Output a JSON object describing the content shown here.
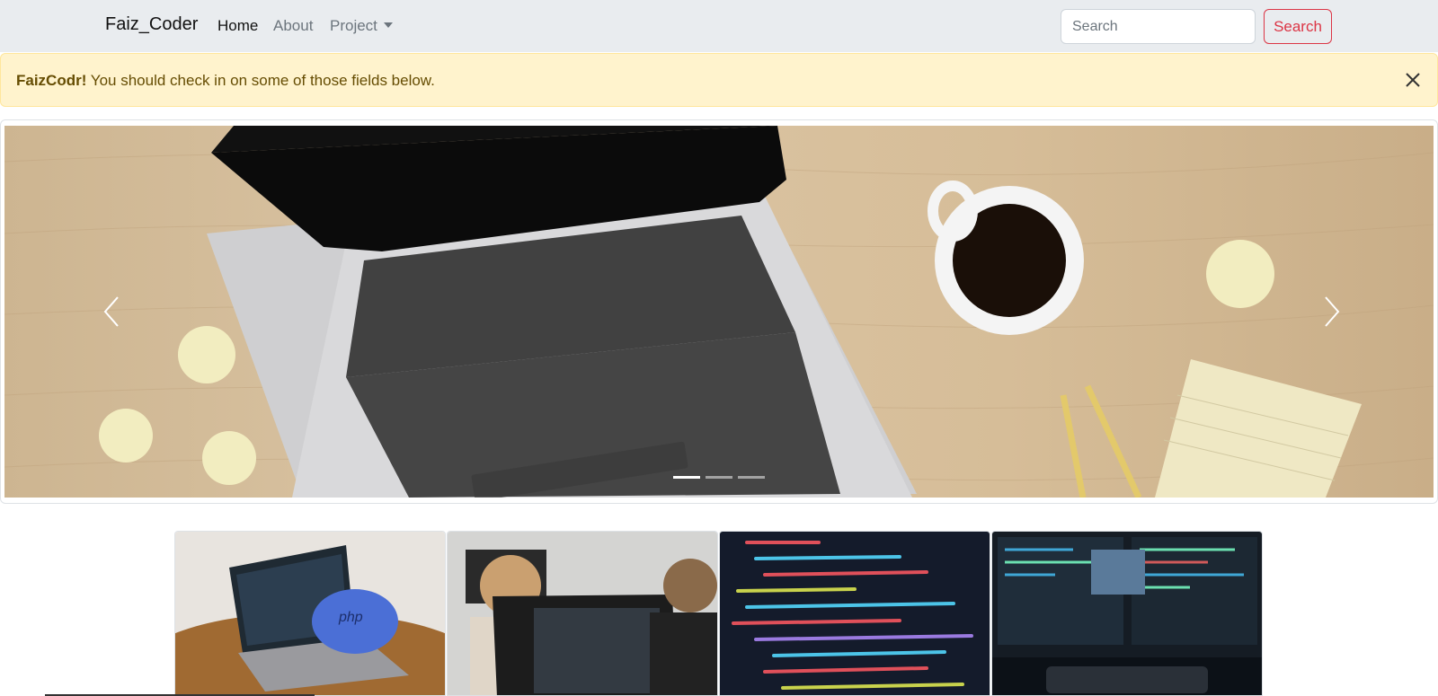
{
  "navbar": {
    "brand": "Faiz_Coder",
    "links": [
      {
        "label": "Home",
        "active": true
      },
      {
        "label": "About",
        "active": false
      },
      {
        "label": "Project",
        "active": false,
        "dropdown": true
      }
    ],
    "search": {
      "placeholder": "Search",
      "button_label": "Search"
    }
  },
  "alert": {
    "strong": "FaizCodr!",
    "message": " You should check in on some of those fields below.",
    "close_icon": "close-icon"
  },
  "carousel": {
    "slides": [
      {
        "name": "laptop-desk-coffee",
        "active": true
      },
      {
        "name": "slide-2",
        "active": false
      },
      {
        "name": "slide-3",
        "active": false
      }
    ],
    "prev_icon": "chevron-left-icon",
    "next_icon": "chevron-right-icon"
  },
  "gallery": {
    "items": [
      {
        "name": "php-elephant-laptop"
      },
      {
        "name": "developers-at-monitors"
      },
      {
        "name": "code-screen-closeup"
      },
      {
        "name": "code-monitors-desk"
      }
    ]
  },
  "colors": {
    "navbar_bg": "#e9ecef",
    "alert_bg": "#fff3cd",
    "alert_text": "#664d03",
    "danger": "#dc3545"
  }
}
